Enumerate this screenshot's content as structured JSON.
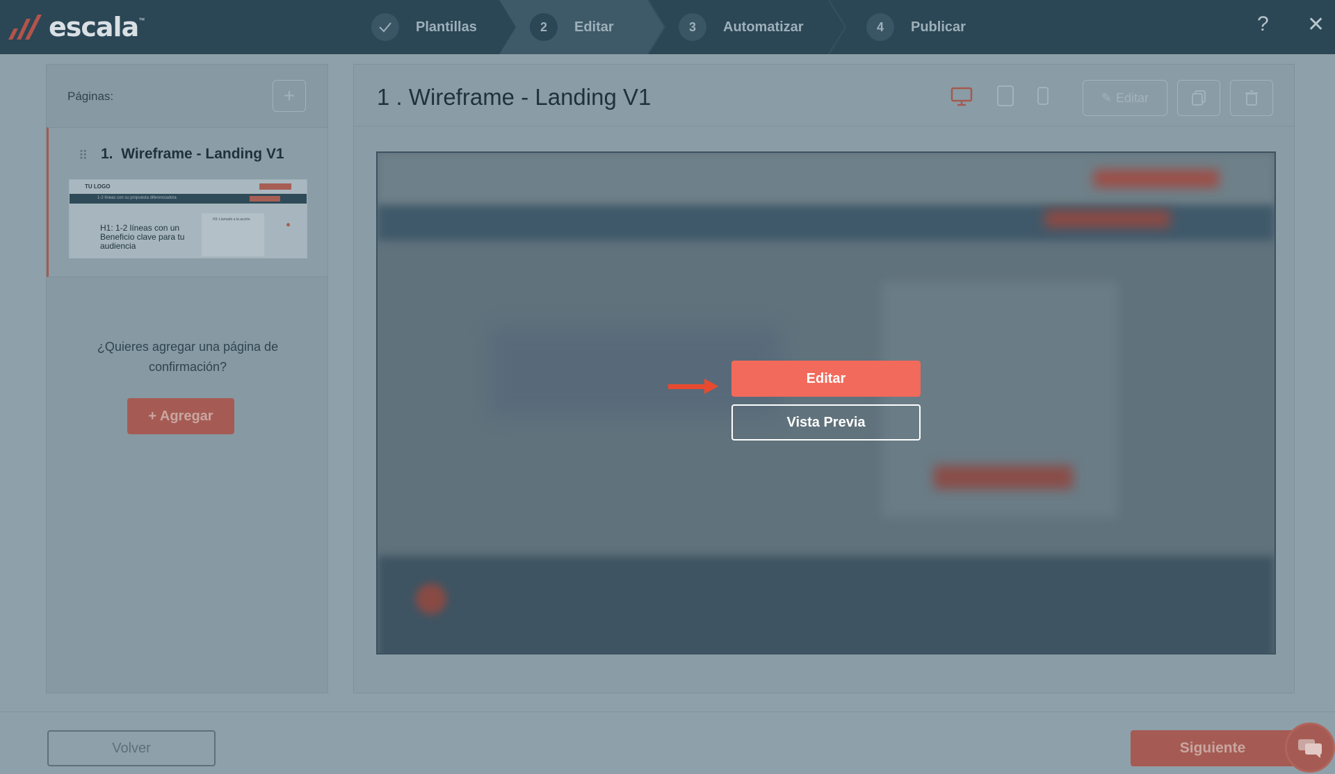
{
  "app": {
    "logo_text": "escala",
    "logo_tm": "™"
  },
  "steps": [
    {
      "number": "",
      "label": "Plantillas",
      "state": "done"
    },
    {
      "number": "2",
      "label": "Editar",
      "state": "active"
    },
    {
      "number": "3",
      "label": "Automatizar",
      "state": "pending"
    },
    {
      "number": "4",
      "label": "Publicar",
      "state": "pending"
    }
  ],
  "top_icons": {
    "help": "?",
    "close": "✕"
  },
  "sidebar": {
    "pages_label": "Páginas:",
    "add_icon": "+",
    "page_items": [
      {
        "number": "1.",
        "title": "Wireframe - Landing V1",
        "thumb_logo": "TU LOGO",
        "thumb_band_text": "1-2 líneas con su propuesta diferenciadora",
        "thumb_h1": "H1: 1-2 líneas con un Beneficio clave para tu audiencia",
        "thumb_form_title": "H3: Llamado a la acción"
      }
    ],
    "confirm_question": "¿Quieres agregar una página de confirmación?",
    "agregar_label": "+ Agregar"
  },
  "main": {
    "page_title": "1 . Wireframe - Landing V1",
    "editar_label": "Editar",
    "overlay_editar": "Editar",
    "overlay_vista_previa": "Vista Previa"
  },
  "footer": {
    "volver_label": "Volver",
    "siguiente_label": "Siguiente"
  },
  "colors": {
    "accent": "#f26a5b",
    "topbar": "#2b4655",
    "overlay_bg": "#8ea0a9"
  }
}
